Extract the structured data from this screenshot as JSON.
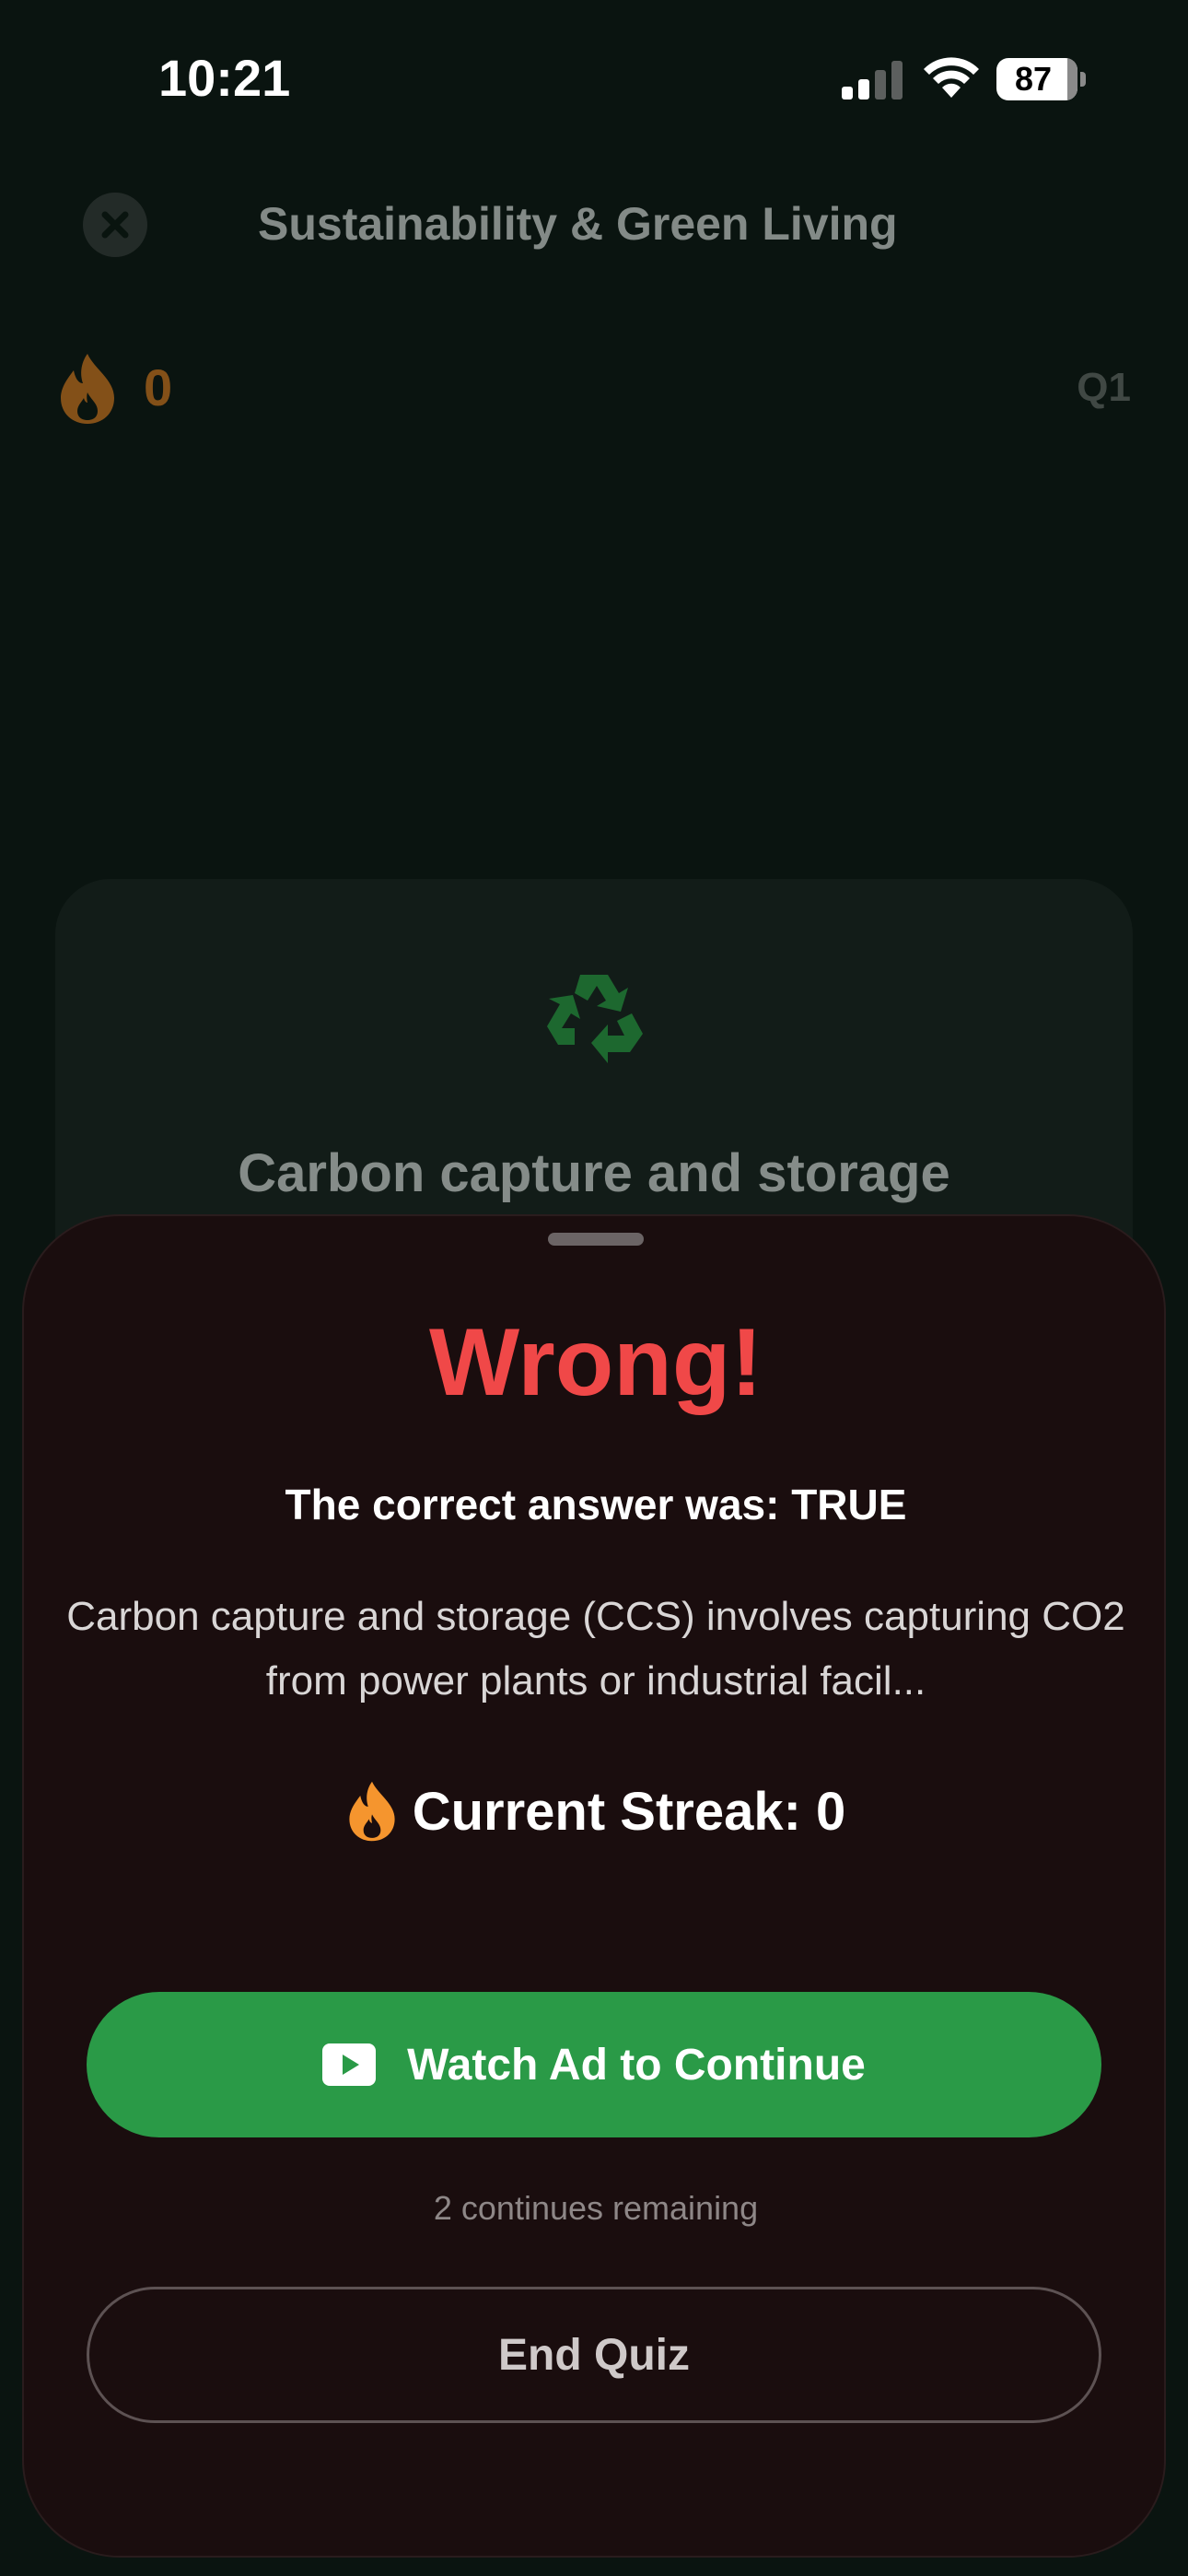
{
  "status_bar": {
    "time": "10:21",
    "battery_percent": "87"
  },
  "header": {
    "title": "Sustainability & Green Living",
    "close_icon": "close-icon"
  },
  "stats": {
    "streak_count": "0",
    "question_number": "Q1"
  },
  "question": {
    "icon": "recycle-icon",
    "text": "Carbon capture and storage"
  },
  "result_sheet": {
    "title": "Wrong!",
    "correct_answer": "The correct answer was: TRUE",
    "explanation": "Carbon capture and storage (CCS) involves capturing CO2 from power plants or industrial facil...",
    "streak_label": "Current Streak: 0",
    "watch_ad_label": "Watch Ad to Continue",
    "continues_remaining": "2 continues remaining",
    "end_quiz_label": "End Quiz"
  },
  "colors": {
    "background": "#0a1410",
    "sheet": "#1a0d0e",
    "wrong_red": "#f04848",
    "primary_green": "#2a9a47",
    "streak_orange": "#e8821f"
  }
}
